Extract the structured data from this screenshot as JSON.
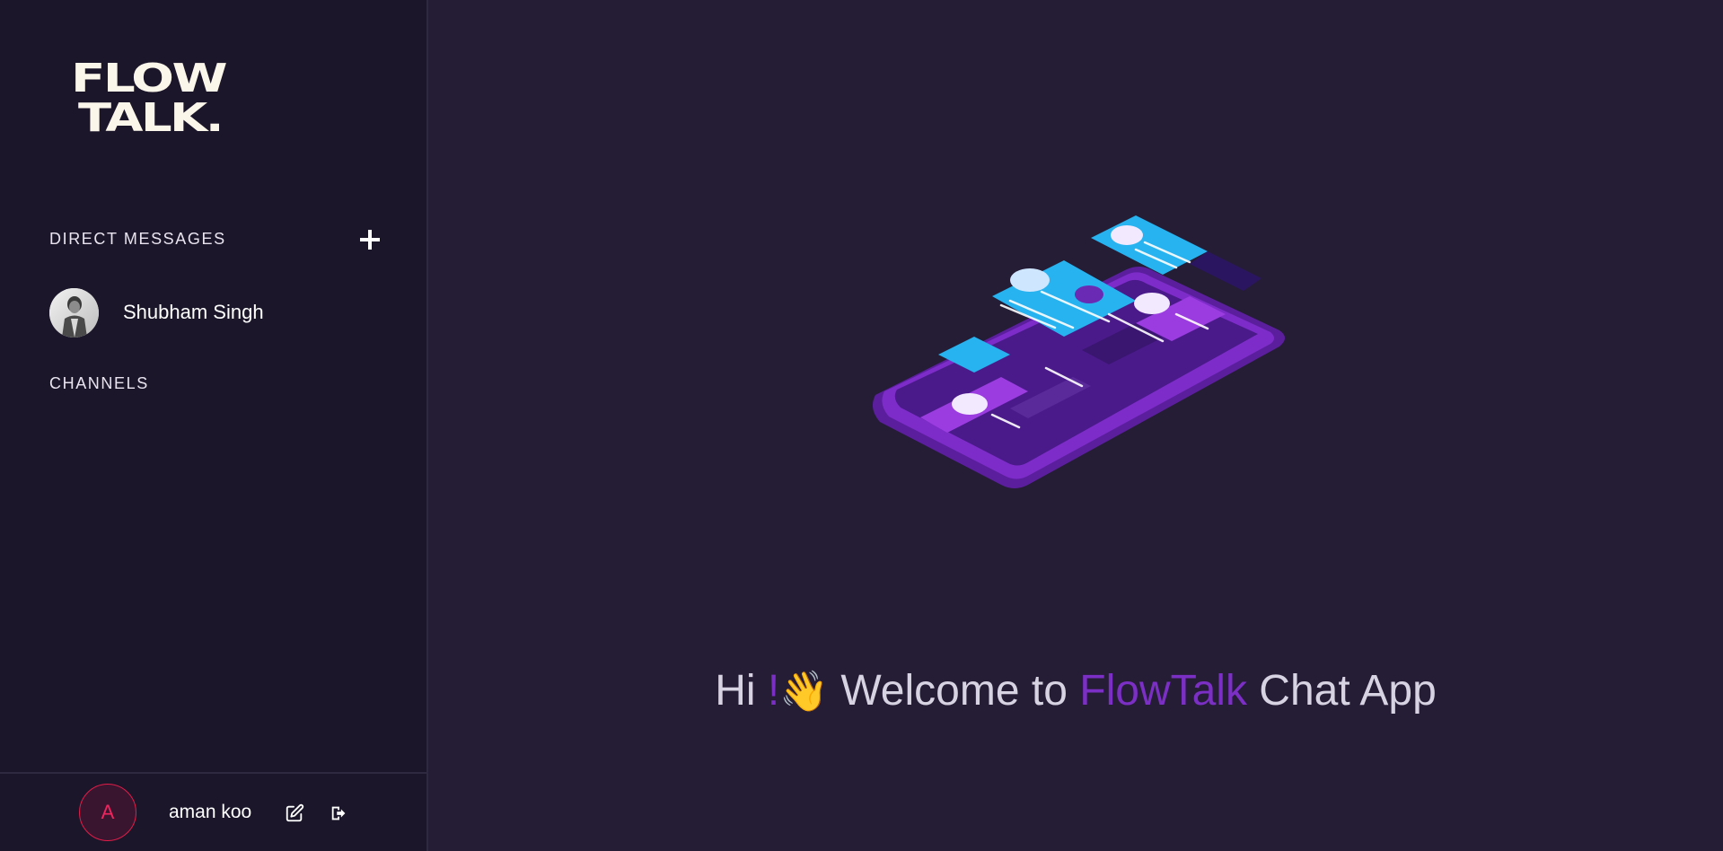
{
  "brand": {
    "logo_line1": "FLOW",
    "logo_line2": "TALK."
  },
  "sidebar": {
    "direct_messages_title": "DIRECT MESSAGES",
    "add_icon": "plus-icon",
    "direct_messages": [
      {
        "name": "Shubham Singh",
        "avatar": "photo"
      }
    ],
    "channels_title": "CHANNELS",
    "channels": []
  },
  "footer": {
    "avatar_initial": "A",
    "user_name": "aman koo",
    "edit_icon": "edit-icon",
    "logout_icon": "logout-icon"
  },
  "main": {
    "welcome_hi": "Hi",
    "welcome_exclaim": "!",
    "welcome_emoji": "👋",
    "welcome_mid": "Welcome to",
    "welcome_brand": "FlowTalk",
    "welcome_end": "Chat App"
  },
  "colors": {
    "sidebar_bg": "#1c162a",
    "main_bg": "#251c36",
    "accent": "#7c2fc4",
    "avatar_ring": "#e11d48"
  }
}
